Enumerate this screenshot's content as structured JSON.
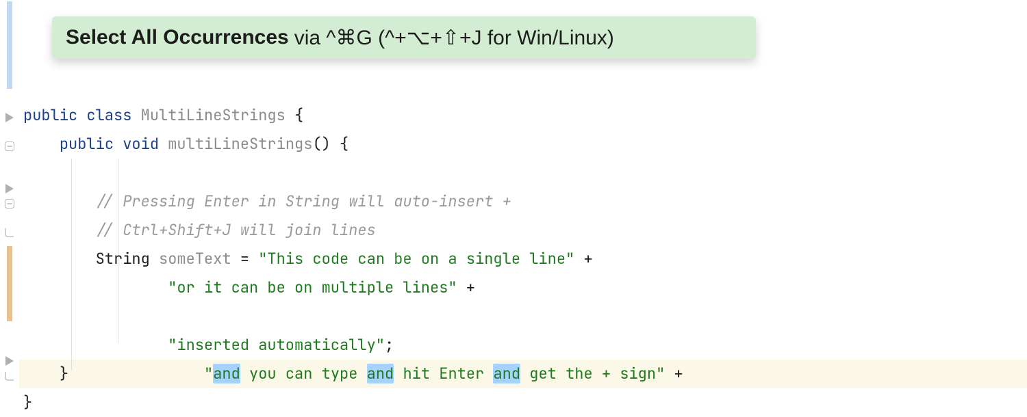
{
  "tip": {
    "bold": "Select All Occurrences",
    "rest": "via ^⌘G (^+⌥+⇧+J for Win/Linux)"
  },
  "colors": {
    "tip_bg": "#d3edd2",
    "selection_bg": "#a6d2ff",
    "current_line_bg": "#fbf8e8",
    "gutter_change_blue": "#c2d8f2",
    "gutter_change_amber": "#e8c28c",
    "keyword": "#1b3f8b",
    "string": "#1f7a1f",
    "comment": "#9a9a9a"
  },
  "selected_word": "and",
  "code": {
    "l1": {
      "kw1": "public",
      "kw2": "class",
      "cls": "MultiLineStrings",
      "brace": " {"
    },
    "l2": {
      "kw1": "public",
      "kw2": "void",
      "mth": "multiLineStrings",
      "parens": "()",
      "brace": " {"
    },
    "l3": "",
    "l4": {
      "cmt": "// Pressing Enter in String will auto-insert +"
    },
    "l5": {
      "cmt": "// Ctrl+Shift+J will join lines"
    },
    "l6": {
      "type": "String",
      "var": "someText",
      "eq": " = ",
      "str": "\"This code can be on a single line\"",
      "plus": " +"
    },
    "l7": {
      "str": "\"or it can be on multiple lines\"",
      "plus": " +"
    },
    "l8": {
      "q": "\"",
      "s1": "and",
      "t1": " you can type ",
      "s2": "and",
      "t2": " hit Enter ",
      "s3": "and",
      "t3": " get the + sign\"",
      "plus": " +"
    },
    "l9": {
      "str": "\"inserted automatically\"",
      "semi": ";"
    },
    "l10": {
      "brace": "}"
    },
    "l11": {
      "brace": "}"
    }
  },
  "gutter_icons": {
    "run": "run-icon",
    "fold_minus": "fold-minus-icon",
    "fold_end": "fold-end-icon"
  }
}
